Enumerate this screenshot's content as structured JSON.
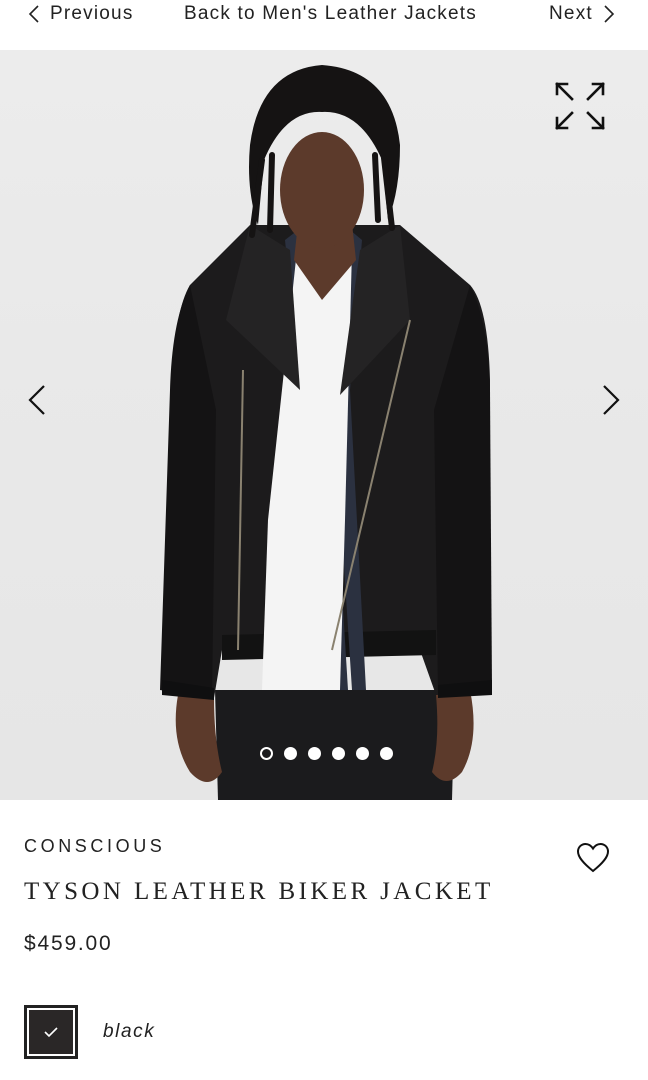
{
  "nav": {
    "previous_label": "Previous",
    "back_label": "Back to Men's Leather Jackets",
    "next_label": "Next"
  },
  "gallery": {
    "image_count": 6,
    "active_index": 0,
    "expand_icon": "expand-arrows-icon",
    "prev_icon": "chevron-left-icon",
    "next_icon": "chevron-right-icon"
  },
  "product": {
    "collection": "CONSCIOUS",
    "name": "TYSON LEATHER BIKER JACKET",
    "price": "$459.00",
    "wishlist_icon": "heart-icon"
  },
  "color": {
    "selected_name": "black",
    "swatch_hex": "#2a2727",
    "selected": true
  },
  "colors": {
    "background": "#ffffff",
    "hero_background": "#e9e9e9",
    "text": "#222222"
  }
}
